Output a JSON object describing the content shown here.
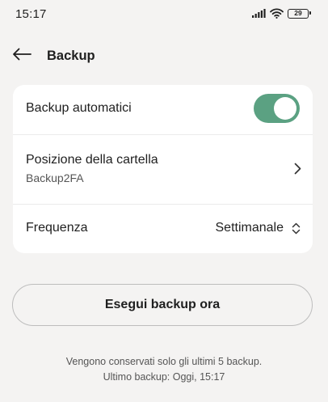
{
  "status_bar": {
    "time": "15:17",
    "battery_level": "29",
    "icons": [
      "signal-icon",
      "wifi-icon",
      "battery-icon"
    ]
  },
  "header": {
    "back_icon": "arrow-left-icon",
    "title": "Backup"
  },
  "settings": {
    "auto_backup": {
      "label": "Backup automatici",
      "enabled": true
    },
    "folder": {
      "label": "Posizione della cartella",
      "value": "Backup2FA",
      "icon": "chevron-right-icon"
    },
    "frequency": {
      "label": "Frequenza",
      "value": "Settimanale",
      "icon": "up-down-chevron-icon"
    }
  },
  "actions": {
    "backup_now_label": "Esegui backup ora"
  },
  "footer": {
    "retention_note": "Vengono conservati solo gli ultimi 5 backup.",
    "last_backup": "Ultimo backup: Oggi, 15:17"
  },
  "colors": {
    "background": "#f4f3f2",
    "card": "#ffffff",
    "toggle_on": "#5ba182",
    "text_primary": "#1f1f1f",
    "text_secondary": "#555555"
  }
}
